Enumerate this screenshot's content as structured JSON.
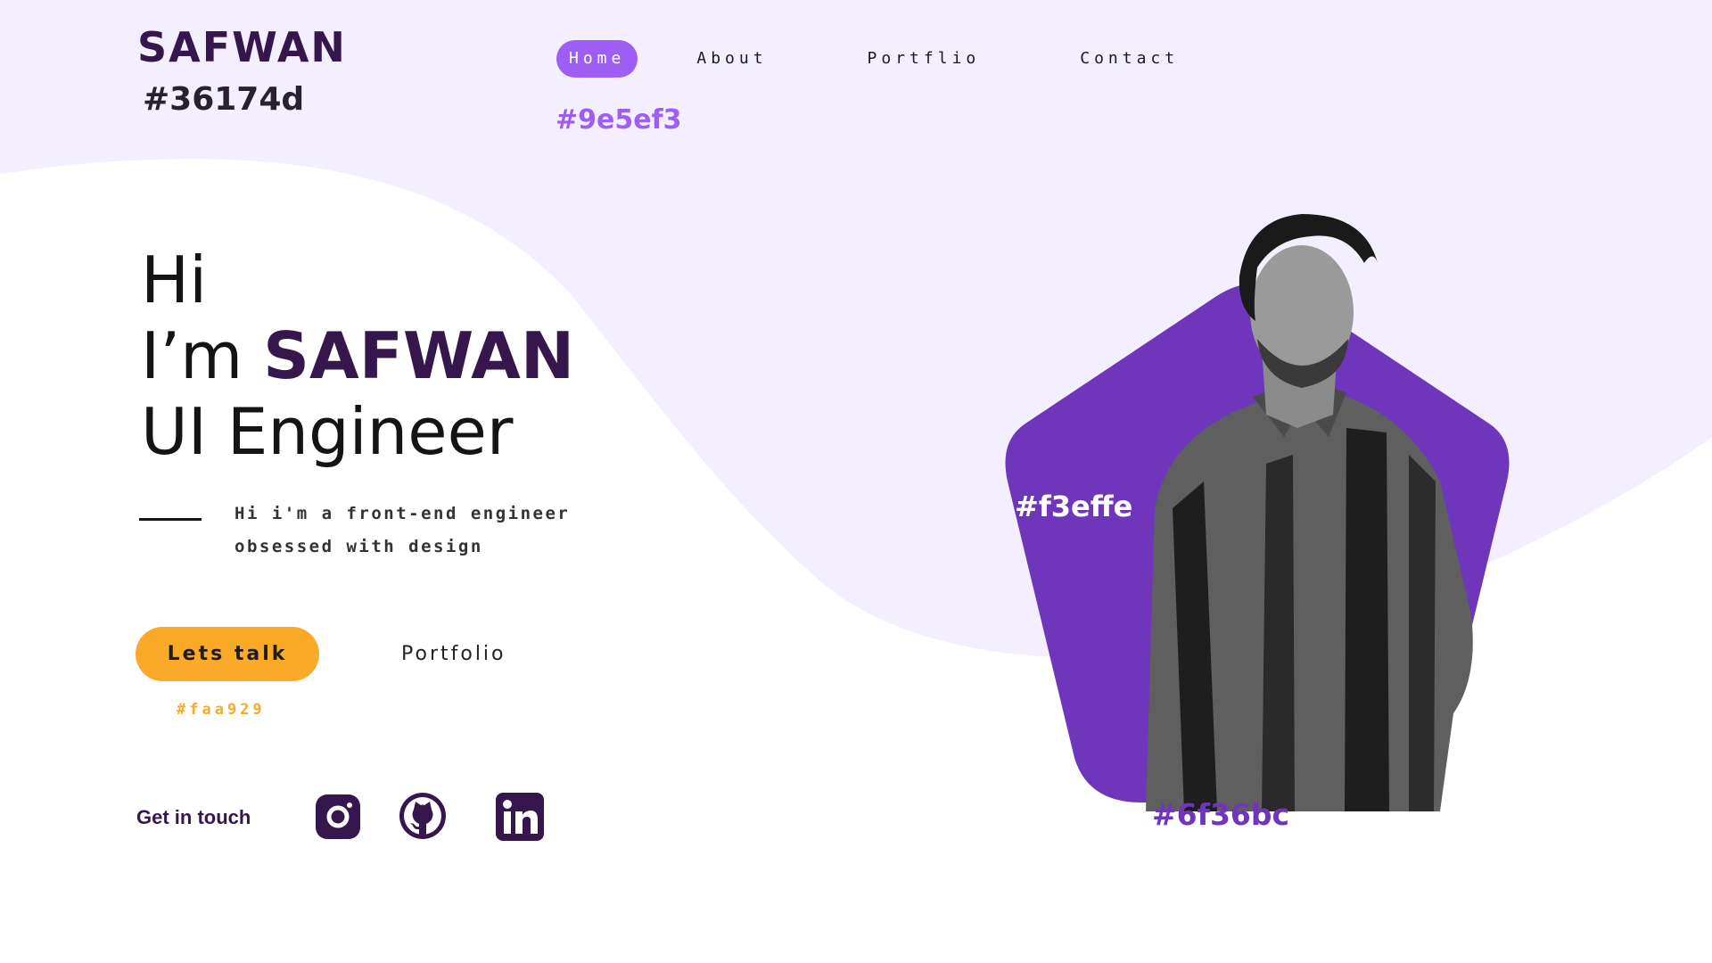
{
  "colors": {
    "brand": "#36174d",
    "wave": "#f3effe",
    "accent": "#9e5ef3",
    "button": "#faa929",
    "shape": "#6f36bc"
  },
  "header": {
    "logo": "SAFWAN",
    "logo_color_note": "#36174d",
    "nav": [
      {
        "label": "Home",
        "active": true
      },
      {
        "label": "About",
        "active": false
      },
      {
        "label": "Portflio",
        "active": false
      },
      {
        "label": "Contact",
        "active": false
      }
    ],
    "nav_color_note": "#9e5ef3"
  },
  "hero": {
    "greeting": "Hi",
    "intro_prefix": "I’m ",
    "name": "SAFWAN",
    "role": "UI Engineer",
    "tagline_line1": "Hi i'm a front-end engineer",
    "tagline_line2": "obsessed with design"
  },
  "actions": {
    "talk_label": "Lets talk",
    "portfolio_label": "Portfolio",
    "button_color_note": "#faa929"
  },
  "contact": {
    "label": "Get in touch",
    "icons": [
      "instagram-icon",
      "github-icon",
      "linkedin-icon"
    ]
  },
  "portrait": {
    "wave_color_note": "#f3effe",
    "shape_color_note": "#6f36bc"
  }
}
